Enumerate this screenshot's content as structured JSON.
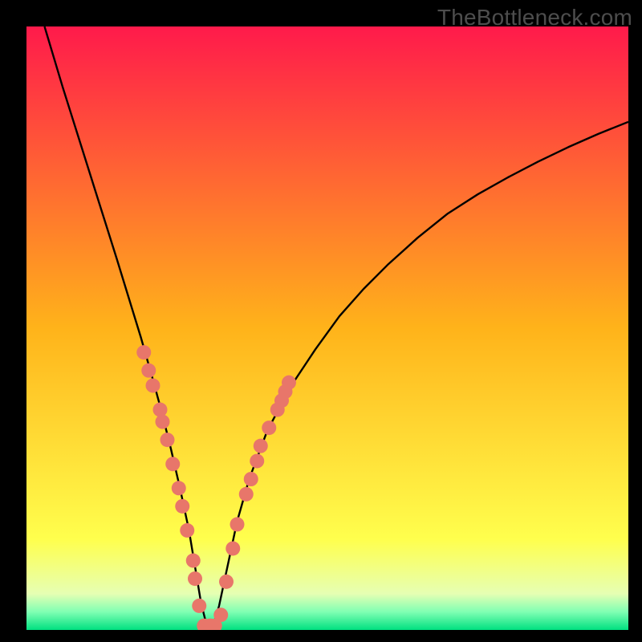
{
  "watermark": "TheBottleneck.com",
  "chart_data": {
    "type": "line",
    "title": "",
    "xlabel": "",
    "ylabel": "",
    "xlim": [
      0,
      100
    ],
    "ylim": [
      0,
      100
    ],
    "grid": false,
    "background_gradient": {
      "direction": "top-to-bottom",
      "stops": [
        {
          "pos": 0.0,
          "color": "#ff1a4b"
        },
        {
          "pos": 0.5,
          "color": "#ffb31a"
        },
        {
          "pos": 0.85,
          "color": "#ffff4d"
        },
        {
          "pos": 0.94,
          "color": "#e6ffb3"
        },
        {
          "pos": 0.97,
          "color": "#80ffb3"
        },
        {
          "pos": 1.0,
          "color": "#00e080"
        }
      ]
    },
    "series": [
      {
        "name": "bottleneck-curve",
        "x": [
          3,
          6,
          9,
          12,
          15,
          17,
          19,
          21,
          22.5,
          24,
          25.5,
          27,
          28,
          29,
          30,
          31,
          32,
          33.5,
          35,
          37,
          40,
          44,
          48,
          52,
          56,
          60,
          65,
          70,
          75,
          80,
          85,
          90,
          95,
          100
        ],
        "y": [
          100,
          90,
          80.5,
          71,
          61.5,
          55,
          48.5,
          41.5,
          36,
          30,
          23.5,
          16.5,
          10.5,
          4.5,
          0.5,
          0.5,
          4,
          11,
          18,
          25,
          33,
          40.5,
          46.5,
          52,
          56.5,
          60.5,
          65,
          69,
          72.2,
          75,
          77.6,
          80,
          82.2,
          84.2
        ]
      }
    ],
    "scatter_overlay": {
      "name": "sample-points",
      "color": "#e8766a",
      "radius": 9,
      "points": [
        {
          "x": 19.5,
          "y": 46
        },
        {
          "x": 20.3,
          "y": 43
        },
        {
          "x": 21.0,
          "y": 40.5
        },
        {
          "x": 22.2,
          "y": 36.5
        },
        {
          "x": 22.6,
          "y": 34.5
        },
        {
          "x": 23.4,
          "y": 31.5
        },
        {
          "x": 24.3,
          "y": 27.5
        },
        {
          "x": 25.3,
          "y": 23.5
        },
        {
          "x": 25.9,
          "y": 20.5
        },
        {
          "x": 26.7,
          "y": 16.5
        },
        {
          "x": 27.7,
          "y": 11.5
        },
        {
          "x": 28.0,
          "y": 8.5
        },
        {
          "x": 28.7,
          "y": 4.0
        },
        {
          "x": 29.5,
          "y": 0.7
        },
        {
          "x": 30.5,
          "y": 0.7
        },
        {
          "x": 31.3,
          "y": 0.7
        },
        {
          "x": 32.3,
          "y": 2.5
        },
        {
          "x": 33.2,
          "y": 8.0
        },
        {
          "x": 34.3,
          "y": 13.5
        },
        {
          "x": 35.0,
          "y": 17.5
        },
        {
          "x": 36.5,
          "y": 22.5
        },
        {
          "x": 37.3,
          "y": 25.0
        },
        {
          "x": 38.3,
          "y": 28.0
        },
        {
          "x": 38.9,
          "y": 30.5
        },
        {
          "x": 40.3,
          "y": 33.5
        },
        {
          "x": 41.7,
          "y": 36.5
        },
        {
          "x": 42.4,
          "y": 38.0
        },
        {
          "x": 43.0,
          "y": 39.5
        },
        {
          "x": 43.6,
          "y": 41.0
        }
      ]
    }
  }
}
